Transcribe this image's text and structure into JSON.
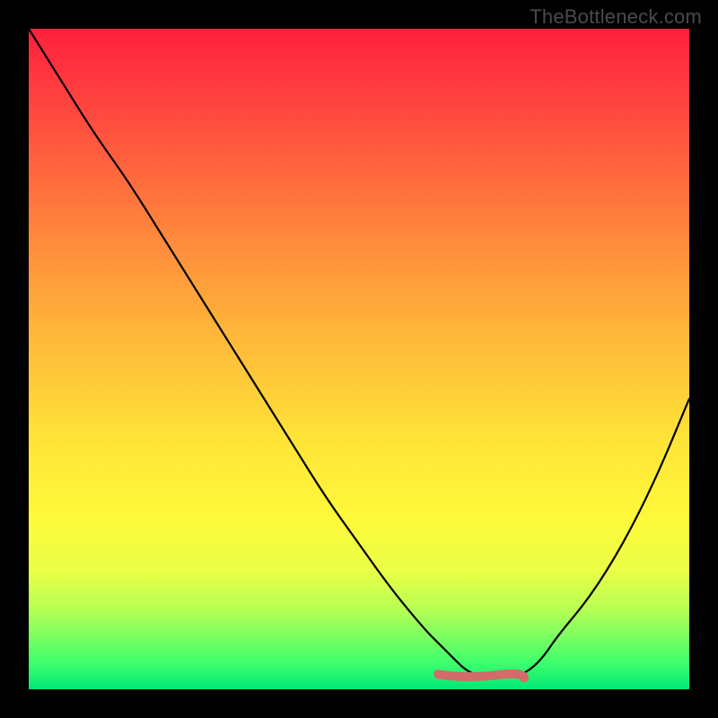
{
  "watermark": "TheBottleneck.com",
  "colors": {
    "frame": "#000000",
    "gradient_top": "#ff1f3a",
    "gradient_mid": "#fff93a",
    "gradient_bottom": "#00e876",
    "curve": "#000000",
    "sweet_spot": "#d46a6a"
  },
  "chart_data": {
    "type": "line",
    "title": "",
    "xlabel": "",
    "ylabel": "",
    "xlim": [
      0,
      100
    ],
    "ylim": [
      0,
      100
    ],
    "grid": false,
    "legend": false,
    "series": [
      {
        "name": "bottleneck-curve",
        "x": [
          0,
          5,
          10,
          15,
          20,
          25,
          30,
          35,
          40,
          45,
          50,
          55,
          60,
          62,
          64,
          66,
          68,
          70,
          72,
          74,
          76,
          78,
          80,
          85,
          90,
          95,
          100
        ],
        "values": [
          100,
          92,
          84,
          77,
          69,
          61,
          53,
          45,
          37,
          29,
          22,
          15,
          9,
          7,
          5,
          3,
          2,
          2,
          2,
          2,
          3,
          5,
          8,
          14,
          22,
          32,
          44
        ]
      }
    ],
    "annotations": [
      {
        "name": "sweet-spot-range",
        "x_start": 62,
        "x_end": 75,
        "y": 2
      }
    ]
  }
}
